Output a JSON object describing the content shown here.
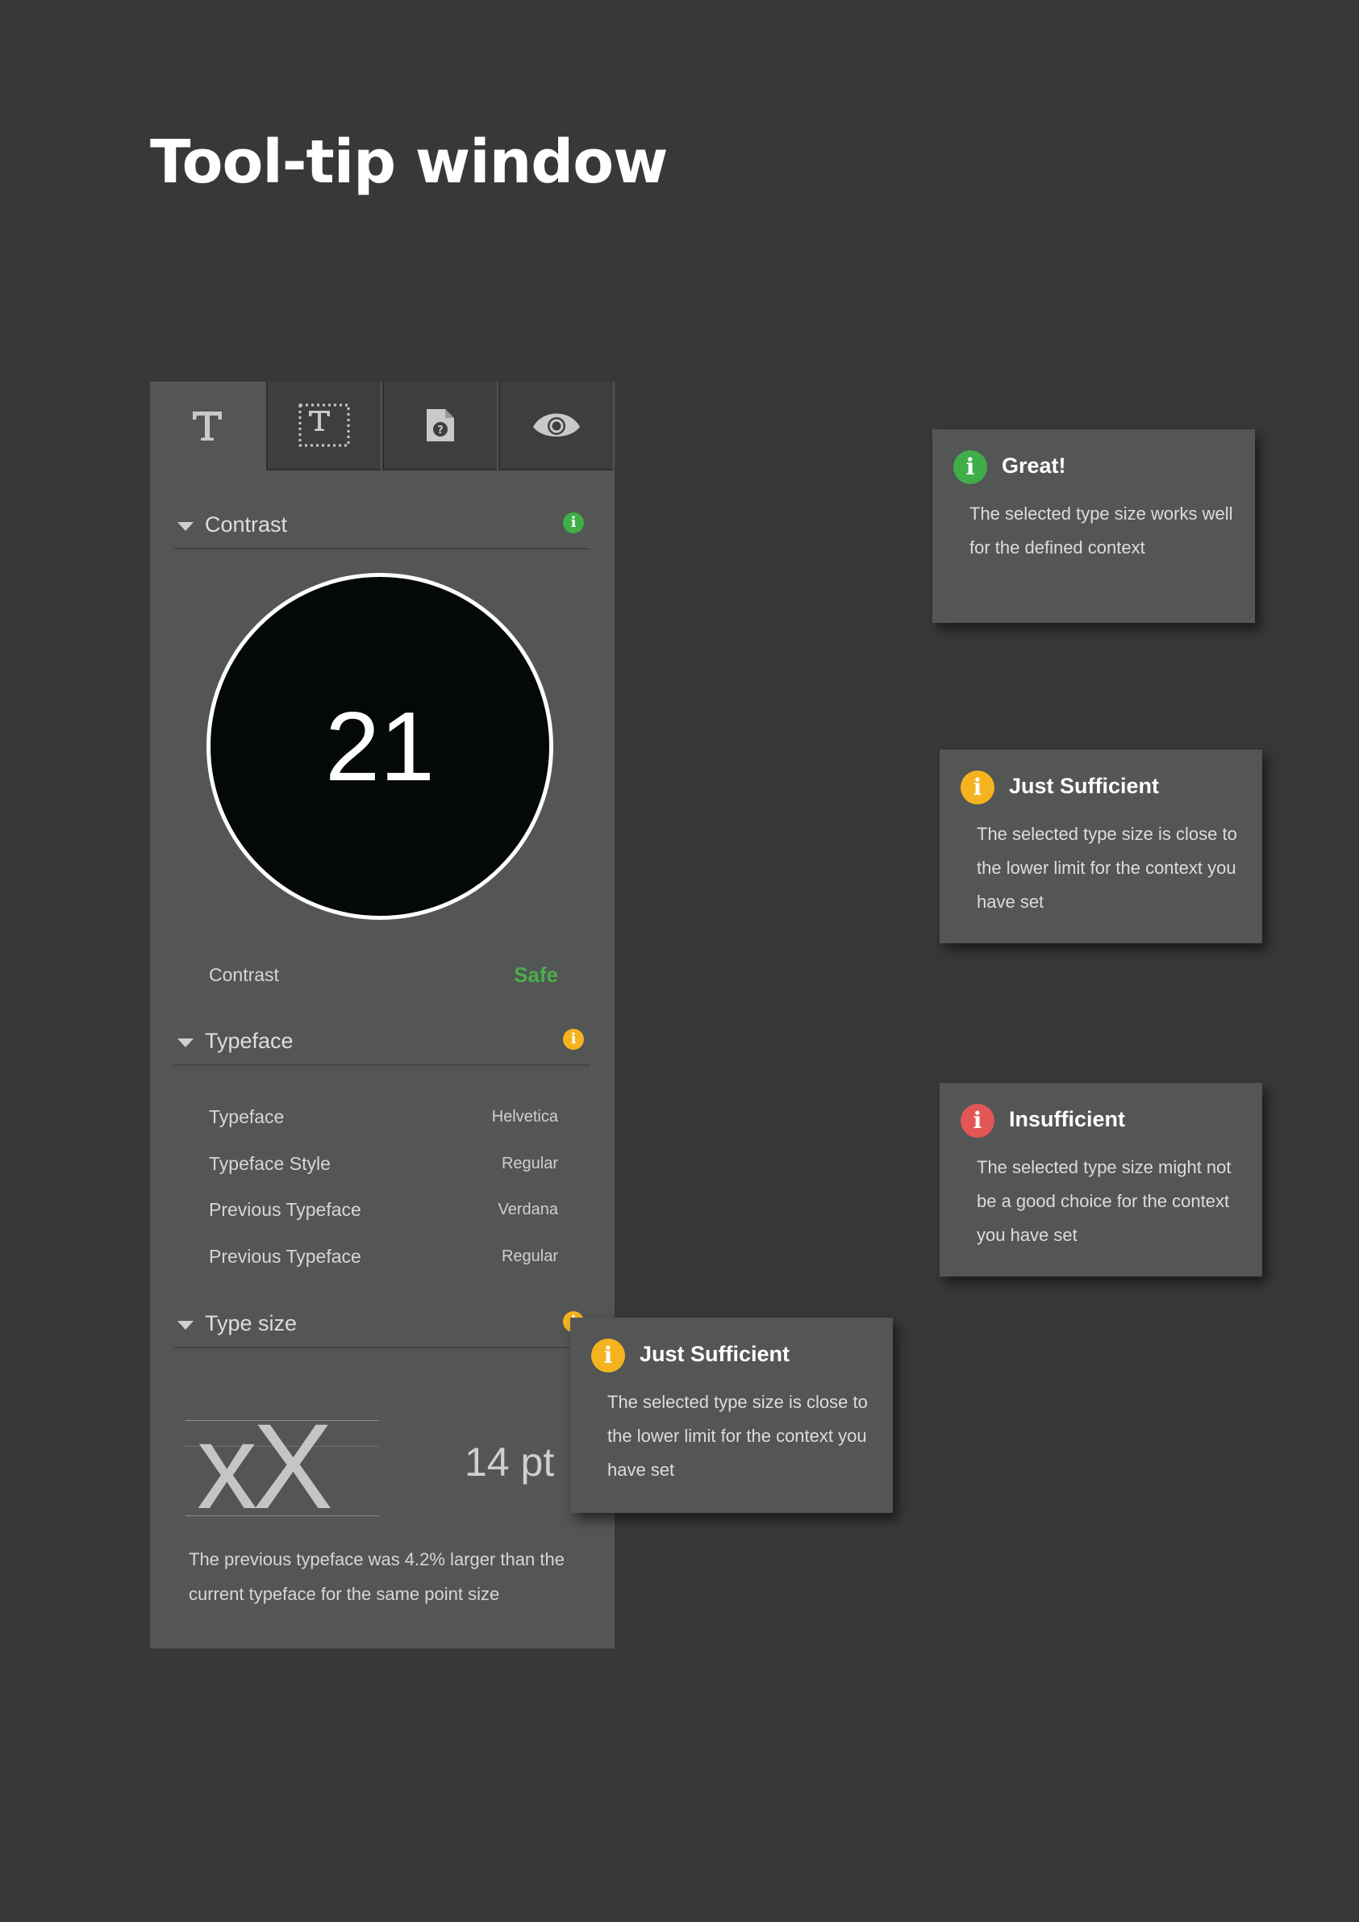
{
  "page": {
    "title": "Tool-tip window"
  },
  "colors": {
    "green": "#3fae49",
    "yellow": "#f5b41f",
    "red": "#e25656",
    "safe": "#4cae4c"
  },
  "tabs": [
    {
      "icon": "text-icon"
    },
    {
      "icon": "text-frame-icon"
    },
    {
      "icon": "document-help-icon"
    },
    {
      "icon": "eye-icon"
    }
  ],
  "panel": {
    "contrast_section": {
      "header": "Contrast",
      "value": "21",
      "label": "Contrast",
      "status": "Safe"
    },
    "typeface_section": {
      "header": "Typeface",
      "rows": [
        {
          "label": "Typeface",
          "value": "Helvetica"
        },
        {
          "label": "Typeface Style",
          "value": "Regular"
        },
        {
          "label": "Previous Typeface",
          "value": "Verdana"
        },
        {
          "label": "Previous Typeface",
          "value": "Regular"
        }
      ]
    },
    "typesize_section": {
      "header": "Type size",
      "sample": "xX",
      "size": "14 pt",
      "note": "The previous typeface was 4.2% larger than the current typeface for the same point size"
    }
  },
  "tooltips": {
    "great": {
      "title": "Great!",
      "body": "The selected type size works well for the defined context"
    },
    "just_sufficient": {
      "title": "Just Sufficient",
      "body": "The selected type size is close to the lower limit for the context you have set"
    },
    "insufficient": {
      "title": "Insufficient",
      "body": "The selected type size might not be a good choice for the context you have set"
    },
    "just_sufficient_overlay": {
      "title": "Just Sufficient",
      "body": "The selected type size is close to the lower limit for the context you have set"
    }
  },
  "icons": {
    "info": "i"
  }
}
